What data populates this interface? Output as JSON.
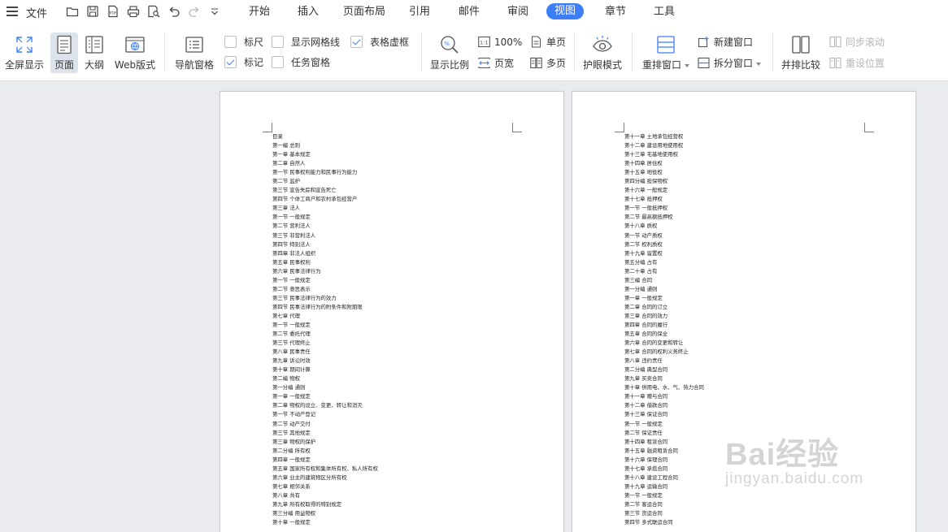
{
  "menu": {
    "file": "文件",
    "tabs": [
      "开始",
      "插入",
      "页面布局",
      "引用",
      "邮件",
      "审阅",
      "视图",
      "章节",
      "工具"
    ],
    "active_tab": "视图",
    "accent": "#3b7ef7"
  },
  "ribbon": {
    "fullscreen": "全屏显示",
    "page": "页面",
    "outline": "大纲",
    "web": "Web版式",
    "nav_pane": "导航窗格",
    "ruler": "标尺",
    "gridlines": "显示网格线",
    "table_grid": "表格虚框",
    "markup": "标记",
    "task_pane": "任务窗格",
    "zoom": "显示比例",
    "pct100": "100%",
    "pagewidth": "页宽",
    "single": "单页",
    "multi": "多页",
    "eyecare": "护眼模式",
    "arrange": "重排窗口",
    "newwin": "新建窗口",
    "split": "拆分窗口",
    "sidebyside": "并排比较",
    "syncscroll": "同步滚动",
    "resetpos": "重设位置",
    "checks": {
      "ruler": false,
      "gridlines": false,
      "table_grid": true,
      "markup": true,
      "task_pane": false
    }
  },
  "page1": [
    "目录",
    "第一编  总则",
    "第一章  基本规定",
    "第二章  自然人",
    "第一节  民事权利能力和民事行为能力",
    "第二节  监护",
    "第三节  宣告失踪和宣告死亡",
    "第四节  个体工商户和农村承包经营户",
    "第三章  法人",
    "第一节  一般规定",
    "第二节  营利法人",
    "第三节  非营利法人",
    "第四节  特别法人",
    "第四章  非法人组织",
    "第五章  民事权利",
    "第六章  民事法律行为",
    "第一节  一般规定",
    "第二节  意思表示",
    "第三节  民事法律行为的效力",
    "第四节  民事法律行为的附条件和附期限",
    "第七章  代理",
    "第一节  一般规定",
    "第二节  委托代理",
    "第三节  代理终止",
    "第八章  民事责任",
    "第九章  诉讼时效",
    "第十章  期间计算",
    "第二编  物权",
    "第一分编  通则",
    "第一章  一般规定",
    "第二章  物权的设立、变更、转让和消灭",
    "第一节  不动产登记",
    "第二节  动产交付",
    "第三节  其他规定",
    "第三章  物权的保护",
    "第二分编  所有权",
    "第四章  一般规定",
    "第五章  国家所有权和集体所有权、私人所有权",
    "第六章  业主的建筑物区分所有权",
    "第七章  相邻关系",
    "第八章  共有",
    "第九章  所有权取得的特别规定",
    "第三分编  用益物权",
    "第十章  一般规定"
  ],
  "page2": [
    "第十一章  土地承包经营权",
    "第十二章  建设用地使用权",
    "第十三章  宅基地使用权",
    "第十四章  居住权",
    "第十五章  地役权",
    "第四分编  担保物权",
    "第十六章  一般规定",
    "第十七章  抵押权",
    "第一节  一般抵押权",
    "第二节  最高额抵押权",
    "第十八章  质权",
    "第一节  动产质权",
    "第二节  权利质权",
    "第十九章  留置权",
    "第五分编  占有",
    "第二十章  占有",
    "第三编  合同",
    "第一分编  通则",
    "第一章  一般规定",
    "第二章  合同的订立",
    "第三章  合同的效力",
    "第四章  合同的履行",
    "第五章  合同的保全",
    "第六章  合同的变更和转让",
    "第七章  合同的权利义务终止",
    "第八章  违约责任",
    "第二分编  典型合同",
    "第九章  买卖合同",
    "第十章  供用电、水、气、热力合同",
    "第十一章  赠与合同",
    "第十二章  借款合同",
    "第十三章  保证合同",
    "第一节  一般规定",
    "第二节  保证责任",
    "第十四章  租赁合同",
    "第十五章  融资租赁合同",
    "第十六章  保理合同",
    "第十七章  承揽合同",
    "第十八章  建设工程合同",
    "第十九章  运输合同",
    "第一节  一般规定",
    "第二节  客运合同",
    "第三节  货运合同",
    "第四节  多式联运合同"
  ],
  "watermark": {
    "brand": "Bai经验",
    "url": "jingyan.baidu.com"
  }
}
